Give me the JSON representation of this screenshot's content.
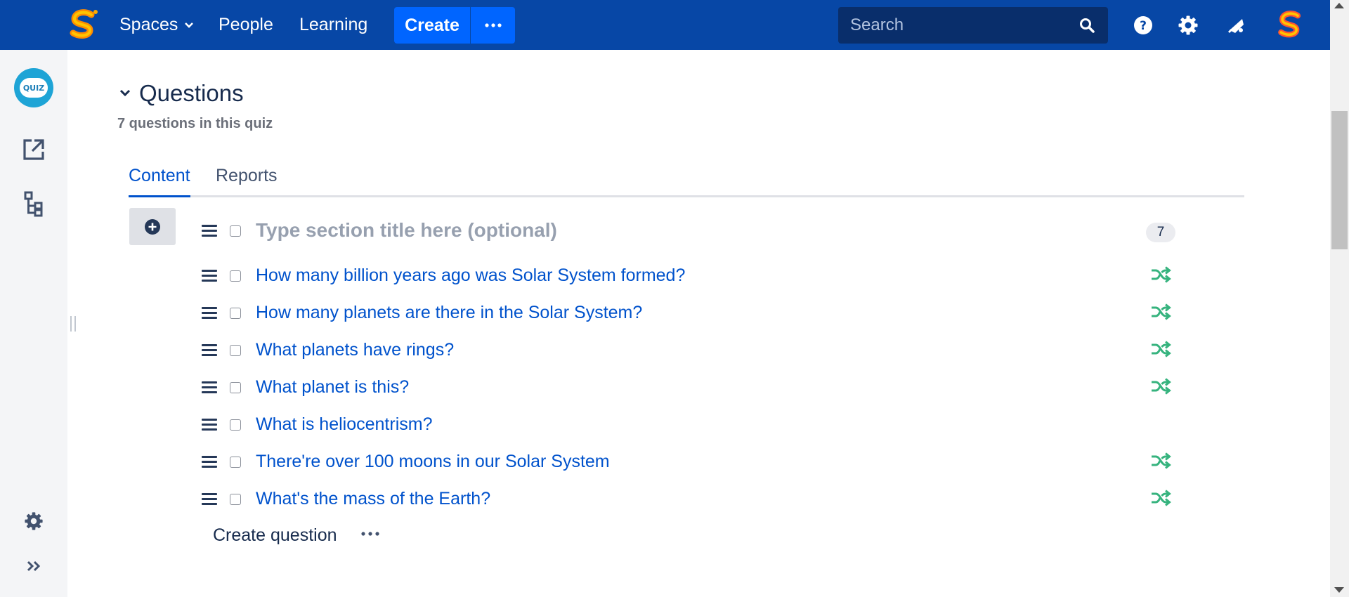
{
  "topnav": {
    "items": [
      "Spaces",
      "People",
      "Learning"
    ],
    "create_label": "Create",
    "search_placeholder": "Search"
  },
  "sidebar": {
    "quiz_logo_text": "QUIZ"
  },
  "questions": {
    "heading": "Questions",
    "subtitle": "7 questions in this quiz",
    "tabs": [
      {
        "label": "Content",
        "active": true
      },
      {
        "label": "Reports",
        "active": false
      }
    ],
    "section": {
      "title_placeholder": "Type section title here (optional)",
      "count": "7"
    },
    "items": [
      {
        "text": "How many billion years ago was Solar System formed?",
        "shuffle": true
      },
      {
        "text": "How many planets are there in the Solar System?",
        "shuffle": true
      },
      {
        "text": "What planets have rings?",
        "shuffle": true
      },
      {
        "text": "What planet is this?",
        "shuffle": true
      },
      {
        "text": "What is heliocentrism?",
        "shuffle": false
      },
      {
        "text": "There're over 100 moons in our Solar System",
        "shuffle": true
      },
      {
        "text": "What's the mass of the Earth?",
        "shuffle": true
      }
    ],
    "create_question_label": "Create question"
  },
  "colors": {
    "topbar": "#0747a6",
    "primary_button": "#0065ff",
    "link": "#0052cc",
    "shuffle": "#36b37e"
  },
  "icons": [
    "menu-icon",
    "app-logo",
    "chevron-down-icon",
    "more-icon",
    "search-icon",
    "help-icon",
    "gear-icon",
    "notifications-icon",
    "user-avatar",
    "quiz-app-icon",
    "external-link-icon",
    "tree-icon",
    "settings-icon",
    "expand-sidebar-icon",
    "plus-circle-icon",
    "drag-handle-icon",
    "shuffle-icon"
  ]
}
